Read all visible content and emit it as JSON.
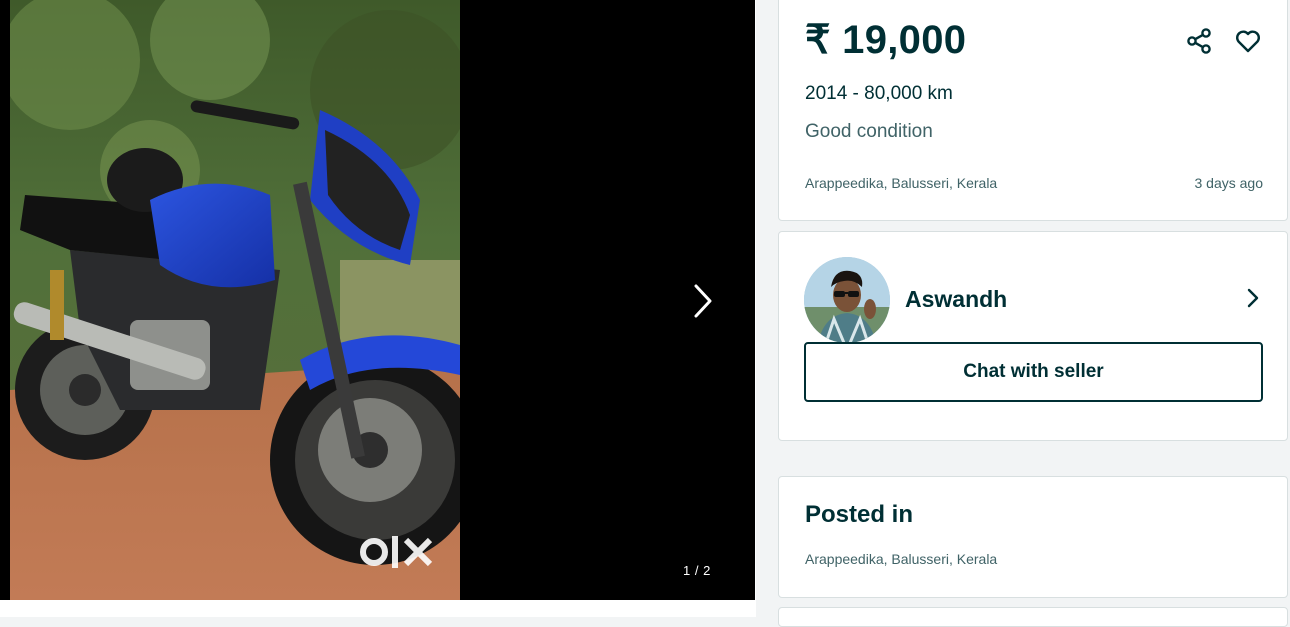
{
  "gallery": {
    "counter": "1 / 2",
    "watermark": "OLX",
    "next_icon": "chevron-right-icon"
  },
  "listing": {
    "price": "₹ 19,000",
    "year_km": "2014 - 80,000 km",
    "condition": "Good condition",
    "location": "Arappeedika, Balusseri, Kerala",
    "posted_time": "3 days ago",
    "share_icon": "share-icon",
    "favorite_icon": "heart-icon"
  },
  "seller": {
    "name": "Aswandh",
    "chat_label": "Chat with seller",
    "chevron_icon": "chevron-right-icon"
  },
  "posted": {
    "title": "Posted in",
    "location": "Arappeedika, Balusseri, Kerala"
  },
  "colors": {
    "brand": "#002f34",
    "secondary_text": "#406367",
    "page_bg": "#f2f4f5",
    "bike_blue": "#1e40c8"
  }
}
